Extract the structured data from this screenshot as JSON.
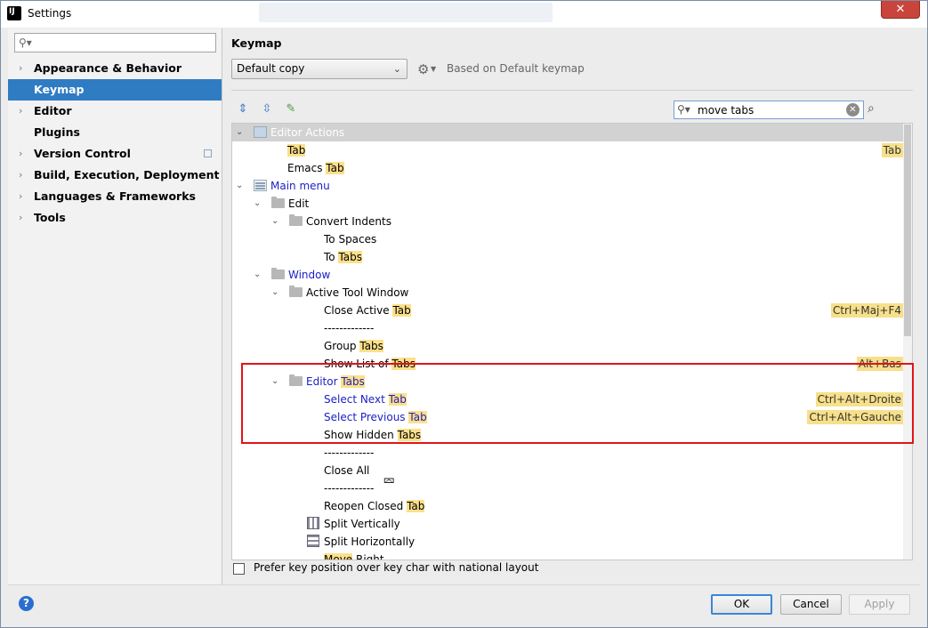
{
  "window": {
    "title": "Settings",
    "close_icon": "close-icon"
  },
  "left": {
    "search_placeholder": "",
    "items": [
      {
        "label": "Appearance & Behavior",
        "expandable": true
      },
      {
        "label": "Keymap",
        "expandable": false,
        "selected": true
      },
      {
        "label": "Editor",
        "expandable": true
      },
      {
        "label": "Plugins",
        "expandable": false
      },
      {
        "label": "Version Control",
        "expandable": true
      },
      {
        "label": "Build, Execution, Deployment",
        "expandable": true
      },
      {
        "label": "Languages & Frameworks",
        "expandable": true
      },
      {
        "label": "Tools",
        "expandable": true
      }
    ]
  },
  "keymap": {
    "title": "Keymap",
    "selected_keymap": "Default copy",
    "based_on": "Based on Default keymap",
    "search_value": "move tabs"
  },
  "tree": [
    {
      "pre": "Editor Actions",
      "hl": "",
      "post": "",
      "blue": false,
      "header": true,
      "shortcut": ""
    },
    {
      "pre": "",
      "hl": "Tab",
      "post": "",
      "blue": false,
      "shortcut": "Tab"
    },
    {
      "pre": "Emacs ",
      "hl": "Tab",
      "post": "",
      "blue": false,
      "shortcut": ""
    },
    {
      "pre": "Main menu",
      "hl": "",
      "post": "",
      "blue": true,
      "shortcut": ""
    },
    {
      "pre": "Edit",
      "hl": "",
      "post": "",
      "blue": false,
      "shortcut": ""
    },
    {
      "pre": "Convert Indents",
      "hl": "",
      "post": "",
      "blue": false,
      "shortcut": ""
    },
    {
      "pre": "To Spaces",
      "hl": "",
      "post": "",
      "blue": false,
      "shortcut": ""
    },
    {
      "pre": "To ",
      "hl": "Tabs",
      "post": "",
      "blue": false,
      "shortcut": ""
    },
    {
      "pre": "Window",
      "hl": "",
      "post": "",
      "blue": true,
      "shortcut": ""
    },
    {
      "pre": "Active Tool Window",
      "hl": "",
      "post": "",
      "blue": false,
      "shortcut": ""
    },
    {
      "pre": "Close Active ",
      "hl": "Tab",
      "post": "",
      "blue": false,
      "shortcut": "Ctrl+Maj+F4"
    },
    {
      "pre": "-------------",
      "hl": "",
      "post": "",
      "blue": false,
      "shortcut": ""
    },
    {
      "pre": "Group ",
      "hl": "Tabs",
      "post": "",
      "blue": false,
      "shortcut": ""
    },
    {
      "pre": "Show List of ",
      "hl": "Tabs",
      "post": "",
      "blue": false,
      "shortcut": "Alt+Bas"
    },
    {
      "pre": "Editor ",
      "hl": "Tabs",
      "post": "",
      "blue": true,
      "shortcut": ""
    },
    {
      "pre": "Select Next ",
      "hl": "Tab",
      "post": "",
      "blue": true,
      "shortcut": "Ctrl+Alt+Droite"
    },
    {
      "pre": "Select Previous ",
      "hl": "Tab",
      "post": "",
      "blue": true,
      "shortcut": "Ctrl+Alt+Gauche"
    },
    {
      "pre": "Show Hidden ",
      "hl": "Tabs",
      "post": "",
      "blue": false,
      "shortcut": ""
    },
    {
      "pre": "-------------",
      "hl": "",
      "post": "",
      "blue": false,
      "shortcut": ""
    },
    {
      "pre": "Close All",
      "hl": "",
      "post": "",
      "blue": false,
      "shortcut": ""
    },
    {
      "pre": "-------------",
      "hl": "",
      "post": "",
      "blue": false,
      "shortcut": ""
    },
    {
      "pre": "Reopen Closed ",
      "hl": "Tab",
      "post": "",
      "blue": false,
      "shortcut": ""
    },
    {
      "pre": "Split Vertically",
      "hl": "",
      "post": "",
      "blue": false,
      "shortcut": ""
    },
    {
      "pre": "Split Horizontally",
      "hl": "",
      "post": "",
      "blue": false,
      "shortcut": ""
    },
    {
      "pre": "",
      "hl": "Move",
      "post": " Right",
      "blue": false,
      "shortcut": ""
    }
  ],
  "prefer_label": "Prefer key position over key char with national layout",
  "buttons": {
    "ok": "OK",
    "cancel": "Cancel",
    "apply": "Apply",
    "help": "?"
  }
}
